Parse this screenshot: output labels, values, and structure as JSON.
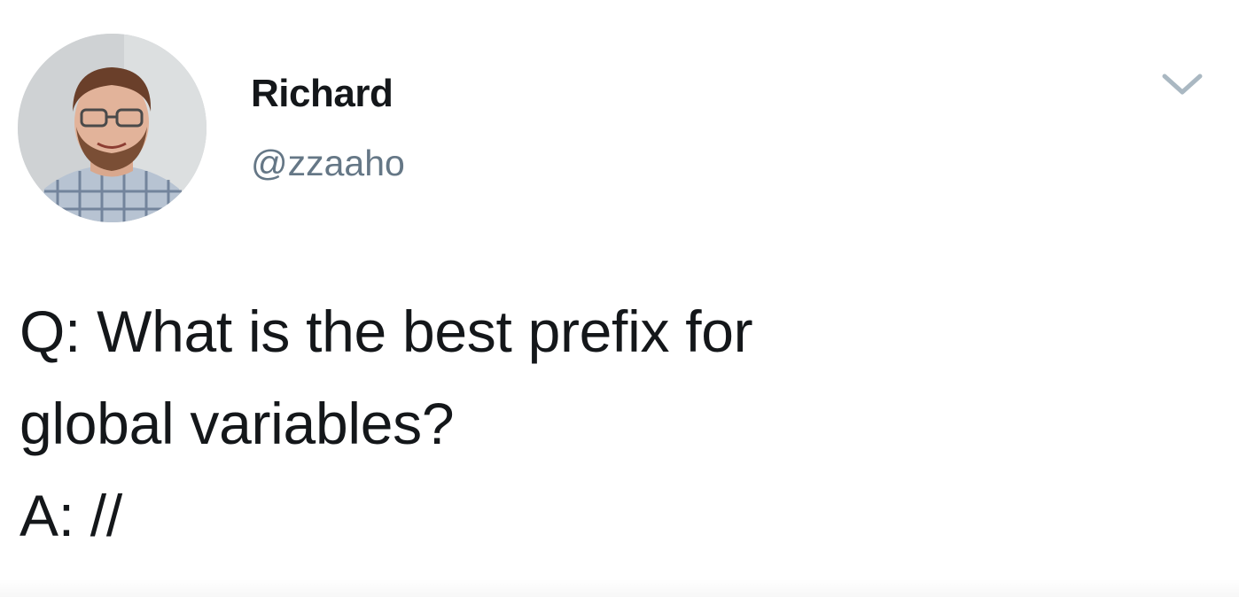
{
  "tweet": {
    "author": {
      "display_name": "Richard",
      "handle": "@zzaaho",
      "avatar_icon": "avatar-photo"
    },
    "menu_icon": "chevron-down-icon",
    "text_lines": [
      "Q: What is the best prefix for",
      "global variables?",
      "A: //"
    ]
  },
  "colors": {
    "text_primary": "#14171a",
    "text_secondary": "#657786",
    "chevron": "#aab8c2",
    "background": "#ffffff"
  }
}
